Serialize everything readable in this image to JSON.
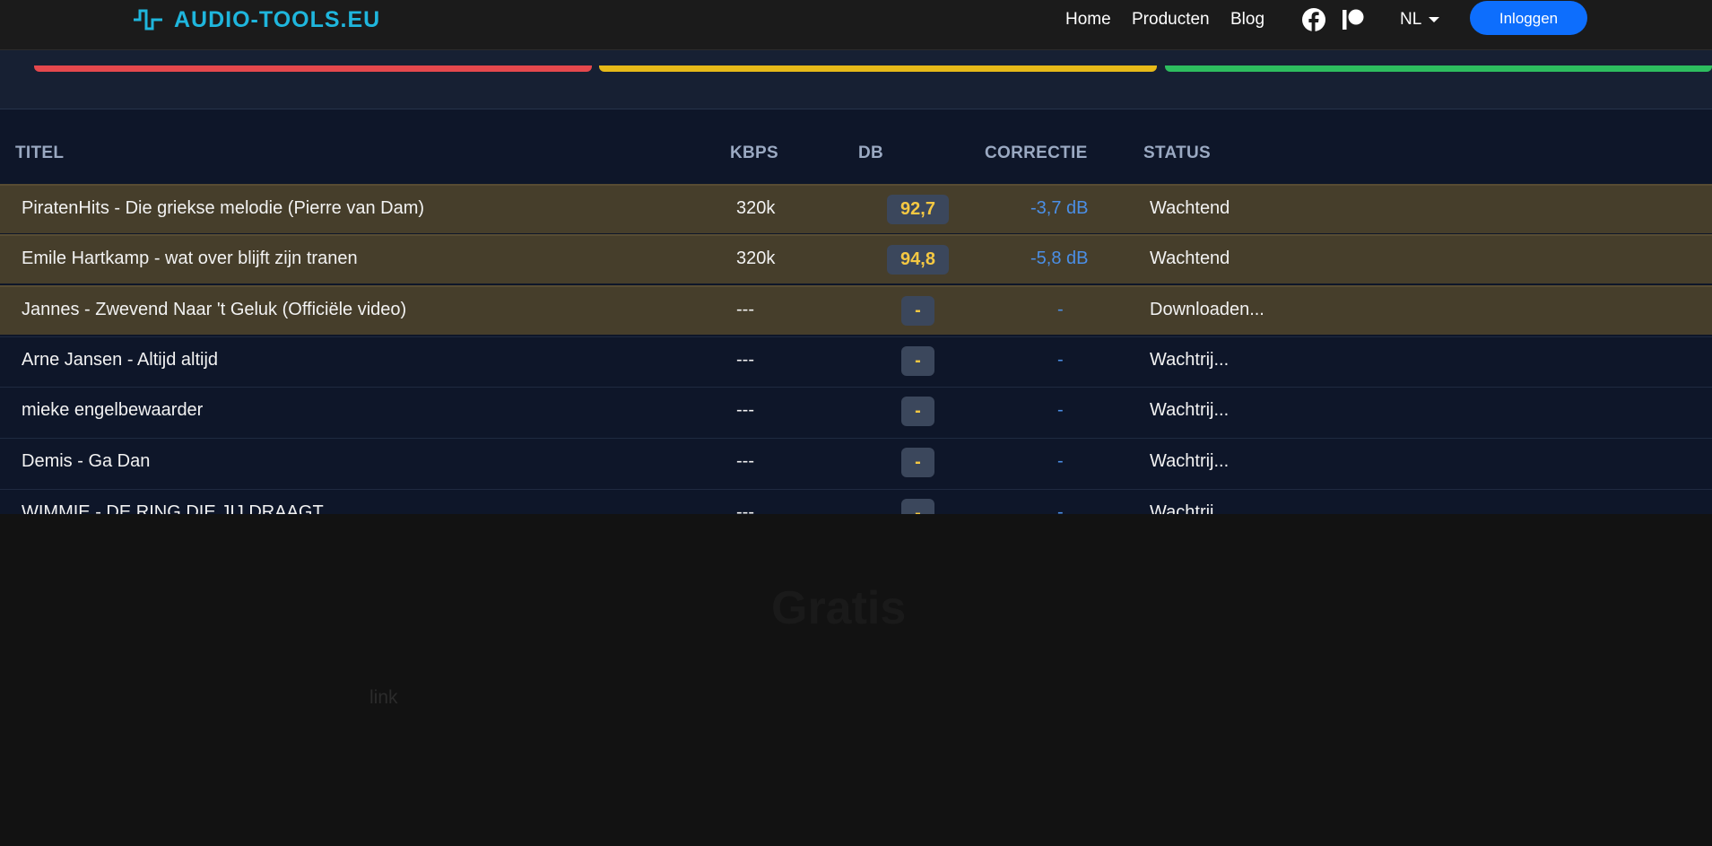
{
  "navbar": {
    "brand": "AUDIO-TOOLS.EU",
    "links": [
      "Home",
      "Producten",
      "Blog"
    ],
    "social_icons": [
      "facebook-icon",
      "patreon-icon"
    ],
    "language": "NL",
    "login_label": "Inloggen",
    "brand_color": "#1fb6dd",
    "login_color": "#0d6efd"
  },
  "status_strip_colors": [
    "#e5484d",
    "#e6b919",
    "#2dbd5f"
  ],
  "table": {
    "headers": [
      "TITEL",
      "KBPS",
      "DB",
      "CORRECTIE",
      "STATUS"
    ],
    "rows": [
      {
        "title": "PiratenHits - Die griekse melodie (Pierre van Dam)",
        "kbps": "320k",
        "db": "92,7",
        "correction": "-3,7 dB",
        "status": "Wachtend"
      },
      {
        "title": "Emile Hartkamp - wat over blijft zijn tranen",
        "kbps": "320k",
        "db": "94,8",
        "correction": "-5,8 dB",
        "status": "Wachtend"
      },
      {
        "title": "Jannes - Zwevend Naar 't Geluk (Officiële video)",
        "kbps": "---",
        "db": "-",
        "correction": "-",
        "status": "Downloaden..."
      },
      {
        "title": "Arne Jansen - Altijd altijd",
        "kbps": "---",
        "db": "-",
        "correction": "-",
        "status": "Wachtrij..."
      },
      {
        "title": "mieke engelbewaarder",
        "kbps": "---",
        "db": "-",
        "correction": "-",
        "status": "Wachtrij..."
      },
      {
        "title": "Demis - Ga Dan",
        "kbps": "---",
        "db": "-",
        "correction": "-",
        "status": "Wachtrij..."
      },
      {
        "title": "WIMMIE - DE RING DIE JIJ DRAAGT",
        "kbps": "---",
        "db": "-",
        "correction": "-",
        "status": "Wachtrij..."
      }
    ]
  },
  "lower": {
    "heading": "Gratis",
    "link": "link"
  }
}
